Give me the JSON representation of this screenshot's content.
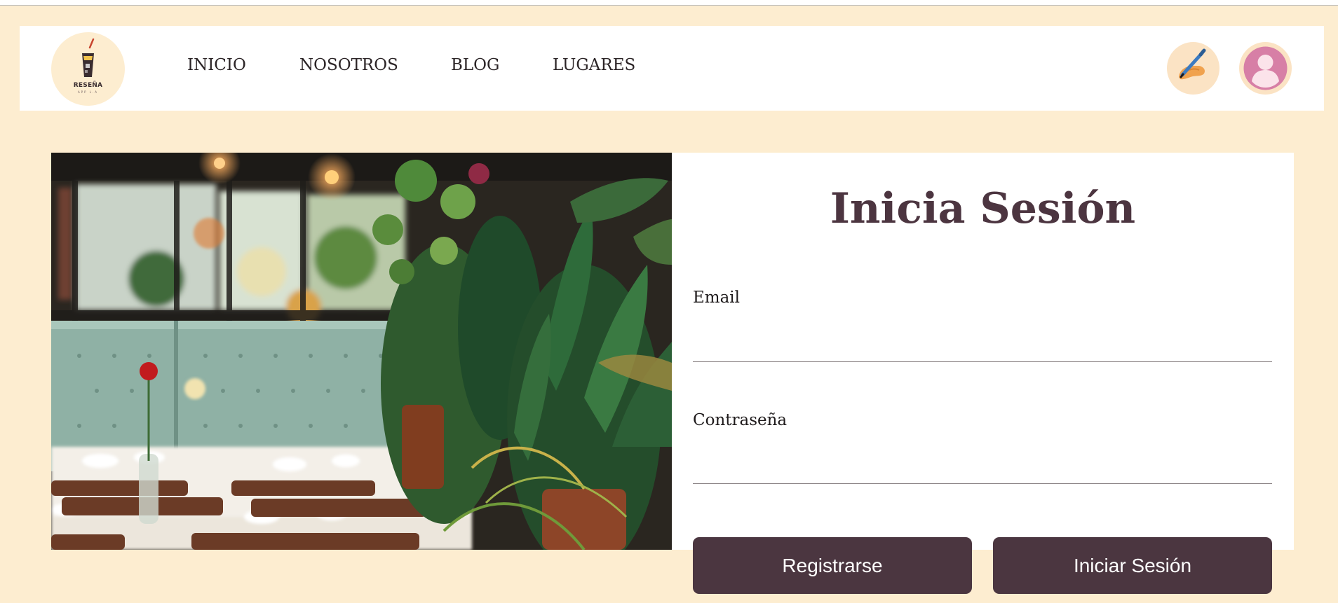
{
  "brand": {
    "logo_text": "RESEÑA",
    "logo_subtext": "APP L.A"
  },
  "nav": {
    "links": [
      {
        "label": "INICIO"
      },
      {
        "label": "NOSOTROS"
      },
      {
        "label": "BLOG"
      },
      {
        "label": "LUGARES"
      }
    ],
    "write_icon": "writing-hand-icon",
    "profile_icon": "user-avatar-icon"
  },
  "hero_image": {
    "subject": "restaurant-interior-photo"
  },
  "login": {
    "title": "Inicia Sesión",
    "email_label": "Email",
    "email_value": "",
    "password_label": "Contraseña",
    "password_value": "",
    "register_button": "Registrarse",
    "login_button": "Iniciar Sesión"
  },
  "colors": {
    "background": "#fdedd0",
    "accent": "#4b3640",
    "title": "#4c3540",
    "avatar": "#d77fa6"
  }
}
